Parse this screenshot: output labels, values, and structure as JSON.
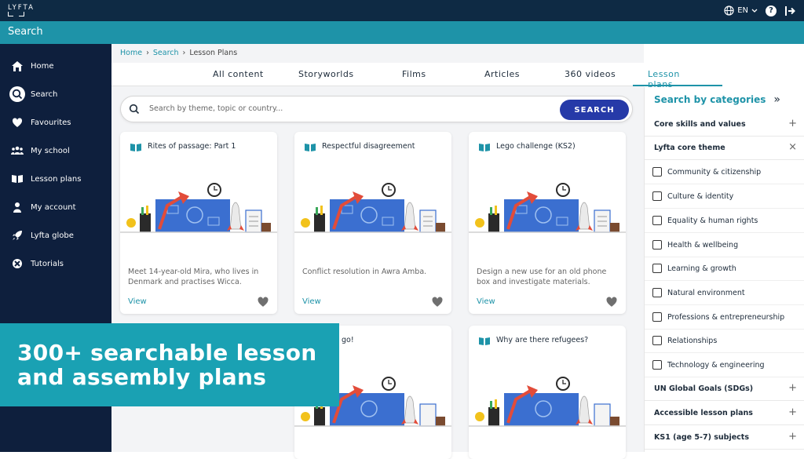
{
  "topbar": {
    "logo_text": "LYFTA",
    "lang": "EN",
    "help": "?"
  },
  "searchbar": {
    "title": "Search"
  },
  "sidebar": {
    "items": [
      {
        "label": "Home",
        "icon": "home-icon"
      },
      {
        "label": "Search",
        "icon": "search-icon",
        "active": true
      },
      {
        "label": "Favourites",
        "icon": "heart-icon"
      },
      {
        "label": "My school",
        "icon": "group-icon"
      },
      {
        "label": "Lesson plans",
        "icon": "book-icon"
      },
      {
        "label": "My account",
        "icon": "person-icon"
      },
      {
        "label": "Lyfta globe",
        "icon": "rocket-icon"
      },
      {
        "label": "Tutorials",
        "icon": "tutorial-icon"
      }
    ]
  },
  "breadcrumb": {
    "home": "Home",
    "search": "Search",
    "current": "Lesson Plans",
    "sep": "›"
  },
  "tabs": [
    "All content",
    "Storyworlds",
    "Films",
    "Articles",
    "360 videos",
    "Lesson plans"
  ],
  "search": {
    "placeholder": "Search by theme, topic or country...",
    "button": "SEARCH"
  },
  "cards": [
    {
      "title": "Rites of passage: Part 1",
      "desc": "Meet 14-year-old Mira, who lives in Denmark and practises Wicca.",
      "view": "View"
    },
    {
      "title": "Respectful disagreement",
      "desc": "Conflict resolution in Awra Amba.",
      "view": "View"
    },
    {
      "title": "Lego challenge (KS2)",
      "desc": "Design a new use for an old phone box and investigate materials.",
      "view": "View"
    },
    {
      "title": "go!",
      "desc": "",
      "view": ""
    },
    {
      "title": "Why are there refugees?",
      "desc": "",
      "view": ""
    }
  ],
  "panel": {
    "heading": "Search by categories",
    "rows_top": [
      {
        "label": "Core skills and values",
        "icon": "+"
      },
      {
        "label": "Lyfta core theme",
        "icon": "×"
      }
    ],
    "checks": [
      "Community & citizenship",
      "Culture & identity",
      "Equality & human rights",
      "Health & wellbeing",
      "Learning & growth",
      "Natural environment",
      "Professions & entrepreneurship",
      "Relationships",
      "Technology & engineering"
    ],
    "rows_bottom": [
      {
        "label": "UN Global Goals (SDGs)",
        "icon": "+"
      },
      {
        "label": "Accessible lesson plans",
        "icon": "+"
      },
      {
        "label": "KS1 (age 5-7) subjects",
        "icon": "+"
      }
    ]
  },
  "banner": {
    "line1": "300+ searchable lesson",
    "line2": "and assembly plans"
  }
}
